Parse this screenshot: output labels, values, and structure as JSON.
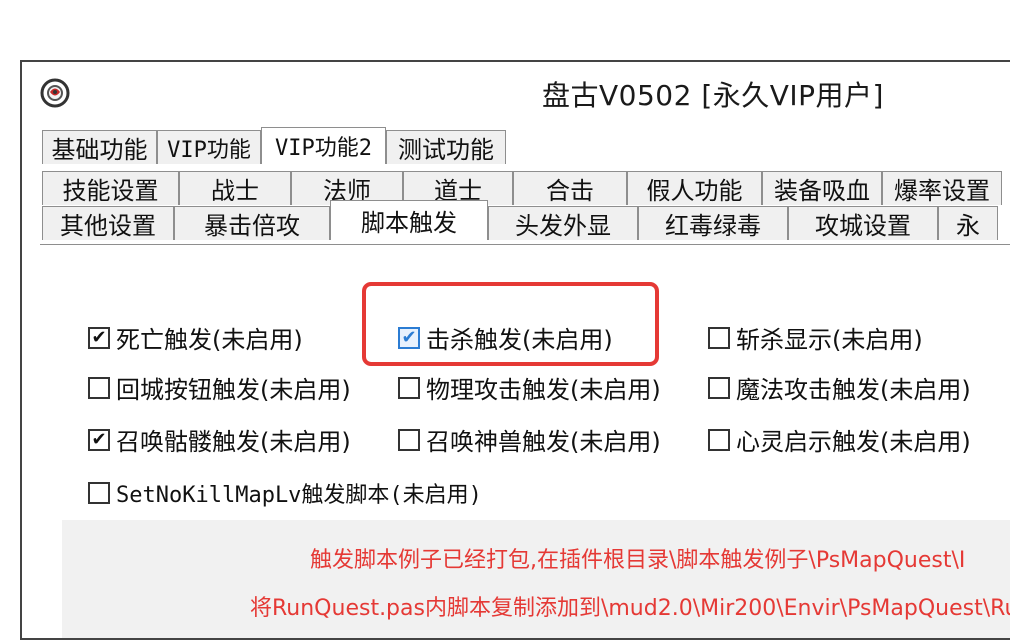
{
  "window": {
    "title": "盘古V0502 [永久VIP用户]"
  },
  "icons": {
    "app": "app-logo-icon",
    "checkmark": "checkmark-icon"
  },
  "tabs": {
    "row1": [
      {
        "label": "基础功能",
        "active": false
      },
      {
        "label": "VIP功能",
        "active": false
      },
      {
        "label": "VIP功能2",
        "active": true
      },
      {
        "label": "测试功能",
        "active": false
      }
    ],
    "row2": [
      {
        "label": "技能设置"
      },
      {
        "label": "战士"
      },
      {
        "label": "法师"
      },
      {
        "label": "道士"
      },
      {
        "label": "合击"
      },
      {
        "label": "假人功能"
      },
      {
        "label": "装备吸血"
      },
      {
        "label": "爆率设置"
      }
    ],
    "row3": [
      {
        "label": "其他设置",
        "active": false
      },
      {
        "label": "暴击倍攻",
        "active": false
      },
      {
        "label": "脚本触发",
        "active": true
      },
      {
        "label": "头发外显",
        "active": false
      },
      {
        "label": "红毒绿毒",
        "active": false
      },
      {
        "label": "攻城设置",
        "active": false
      },
      {
        "label": "永",
        "active": false
      }
    ]
  },
  "options": [
    {
      "label": "死亡触发(未启用)",
      "checked": true
    },
    {
      "label": "击杀触发(未启用)",
      "checked": true
    },
    {
      "label": "斩杀显示(未启用)",
      "checked": false
    },
    {
      "label": "回城按钮触发(未启用)",
      "checked": false
    },
    {
      "label": "物理攻击触发(未启用)",
      "checked": false
    },
    {
      "label": "魔法攻击触发(未启用)",
      "checked": false
    },
    {
      "label": "召唤骷髅触发(未启用)",
      "checked": true
    },
    {
      "label": "召唤神兽触发(未启用)",
      "checked": false
    },
    {
      "label": "心灵启示触发(未启用)",
      "checked": false
    },
    {
      "label": "SetNoKillMapLv触发脚本(未启用)",
      "checked": false
    }
  ],
  "notes": {
    "line1": "触发脚本例子已经打包,在插件根目录\\脚本触发例子\\PsMapQuest\\I",
    "line2": "将RunQuest.pas内脚本复制添加到\\mud2.0\\Mir200\\Envir\\PsMapQuest\\Ru"
  },
  "colors": {
    "highlight": "#e53935",
    "note_text": "#e53935",
    "focused_checkbox": "#2b7cd3"
  }
}
